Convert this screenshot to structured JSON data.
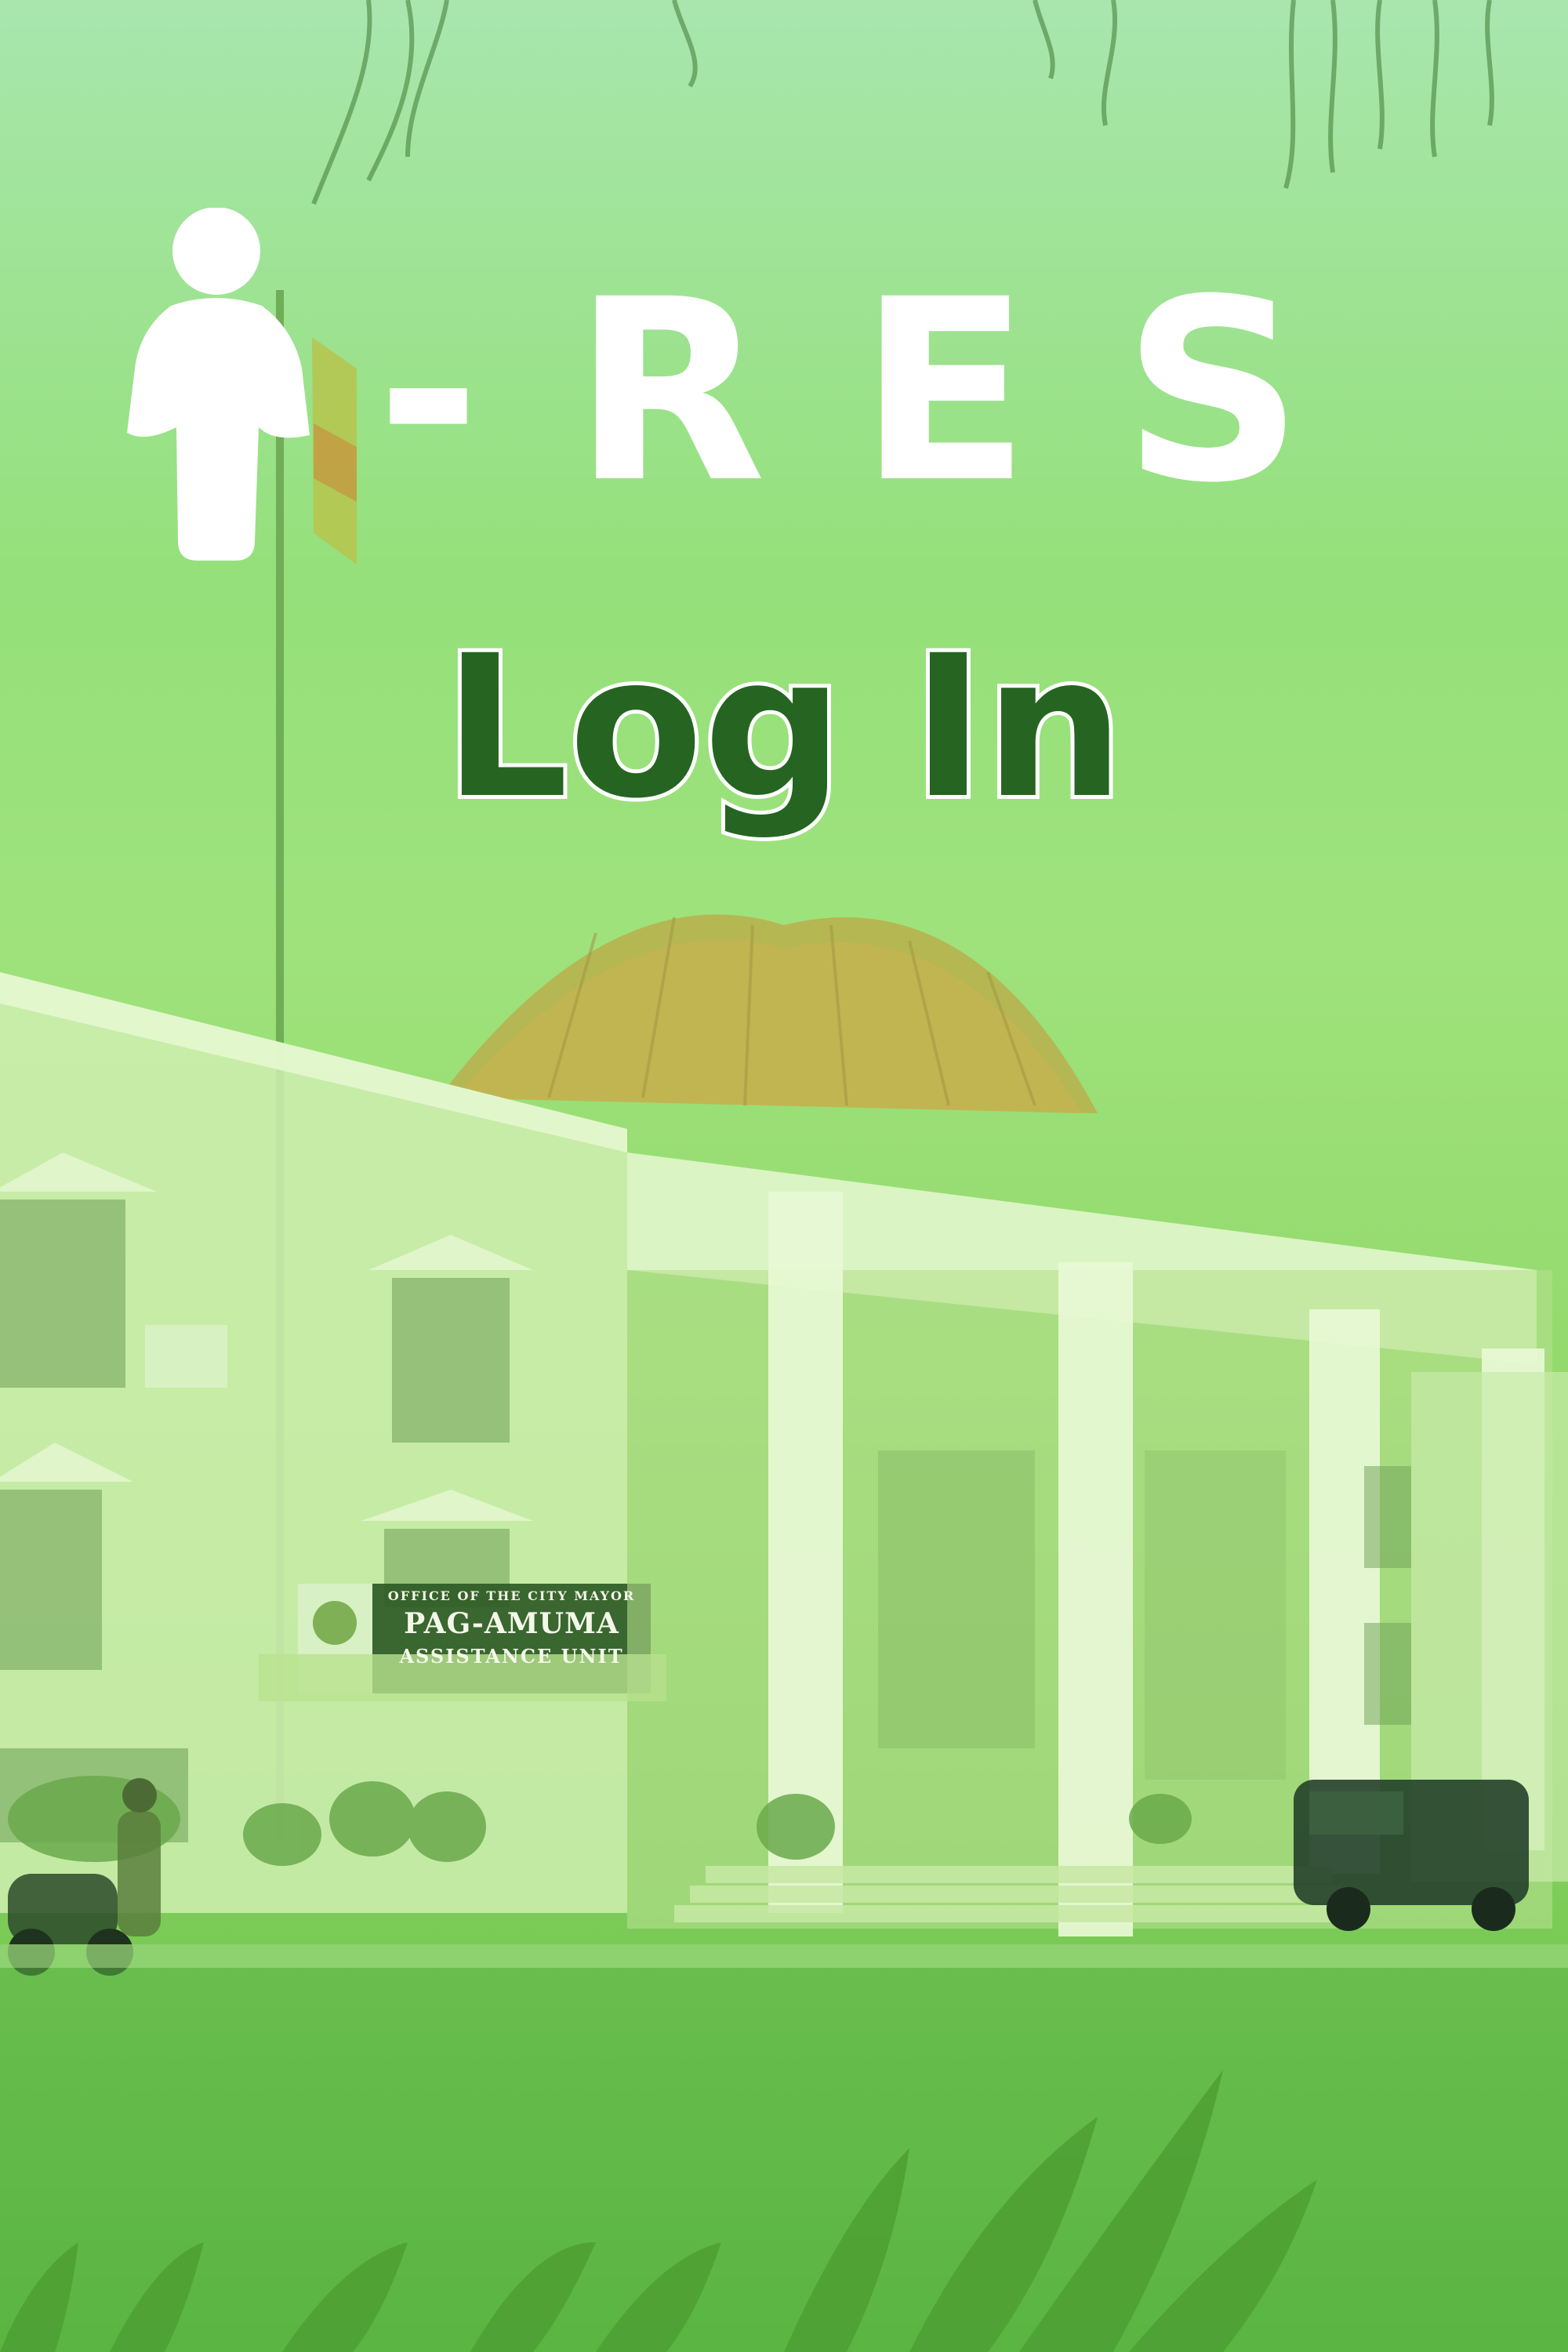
{
  "app": {
    "logo_icon": "person-icon",
    "logo_text": "-RES",
    "colors": {
      "background_top": "#a8e6ae",
      "background_bottom": "#58b63c",
      "title_fill": "#256521",
      "title_outline": "#ffffff",
      "logo": "#ffffff"
    }
  },
  "screen": {
    "title": "Log In"
  },
  "background": {
    "sign": {
      "line1": "OFFICE OF THE CITY MAYOR",
      "line2": "PAG-AMUMA",
      "line3": "ASSISTANCE UNIT"
    }
  }
}
